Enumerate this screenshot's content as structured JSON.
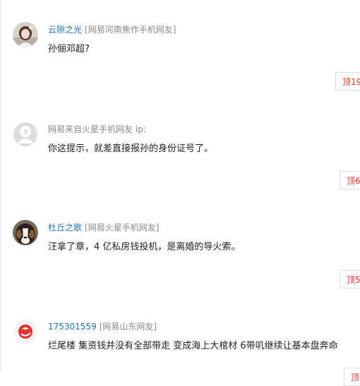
{
  "comments": [
    {
      "username": "云隙之光",
      "location": "[网易河南焦作手机网友]",
      "text": "孙俪邓超?",
      "vote_label": "顶19",
      "avatar_icon": "user-photo-icon"
    },
    {
      "location": "网易来自火星手机网友",
      "ip_label": "ip:",
      "text": "你这提示，就差直接报孙的身份证号了。",
      "vote_label": "顶6",
      "avatar_icon": "anonymous-user-icon"
    },
    {
      "username": "杜丘之歌",
      "location": "[网易火星手机网友]",
      "text": "汪拿了章，4 亿私房钱投机，是离婚的导火索。",
      "vote_label": "顶5",
      "avatar_icon": "dog-avatar-icon"
    },
    {
      "username": "175301559",
      "location": "[网易山东网友]",
      "text": "烂尾楼 集资钱并没有全部带走 变成海上大棺材 6带叽继续让基本盘奔命",
      "vote_label": "顶",
      "avatar_icon": "netease-logo-icon"
    }
  ],
  "colors": {
    "username": "#1e73b4",
    "meta_gray": "#888888",
    "vote_red": "#e3322b",
    "border": "#dcdcdc"
  }
}
